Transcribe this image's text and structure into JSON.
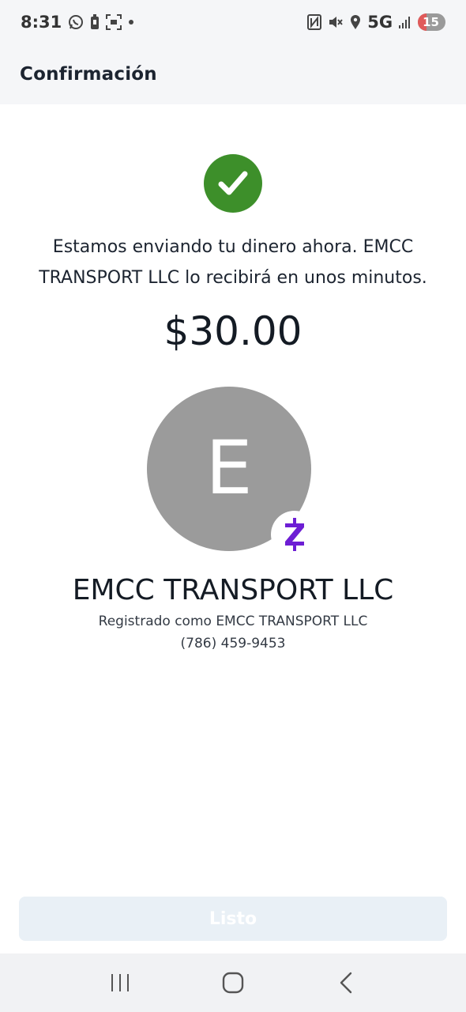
{
  "status_bar": {
    "time": "8:31",
    "network": "5G",
    "battery_level": "15",
    "icons": [
      "whatsapp-icon",
      "battery-saver-icon",
      "screenshot-icon",
      "dot-icon",
      "nfc-icon",
      "mute-icon",
      "location-icon",
      "signal-icon"
    ]
  },
  "header": {
    "title": "Confirmación"
  },
  "confirmation": {
    "message": "Estamos enviando tu dinero ahora. EMCC TRANSPORT LLC lo recibirá en unos minutos.",
    "amount": "$30.00"
  },
  "recipient": {
    "initial": "E",
    "name": "EMCC TRANSPORT LLC",
    "registered_as": "Registrado como EMCC TRANSPORT LLC",
    "phone": "(786) 459-9453",
    "avatar_color": "#9b9b9b",
    "badge_color": "#6d1ed4"
  },
  "actions": {
    "done_label": "Listo"
  },
  "nav": {
    "buttons": [
      "recent-apps-icon",
      "home-icon",
      "back-icon"
    ]
  },
  "colors": {
    "success": "#3d8f2a",
    "button_bg": "#e9f0f6"
  }
}
